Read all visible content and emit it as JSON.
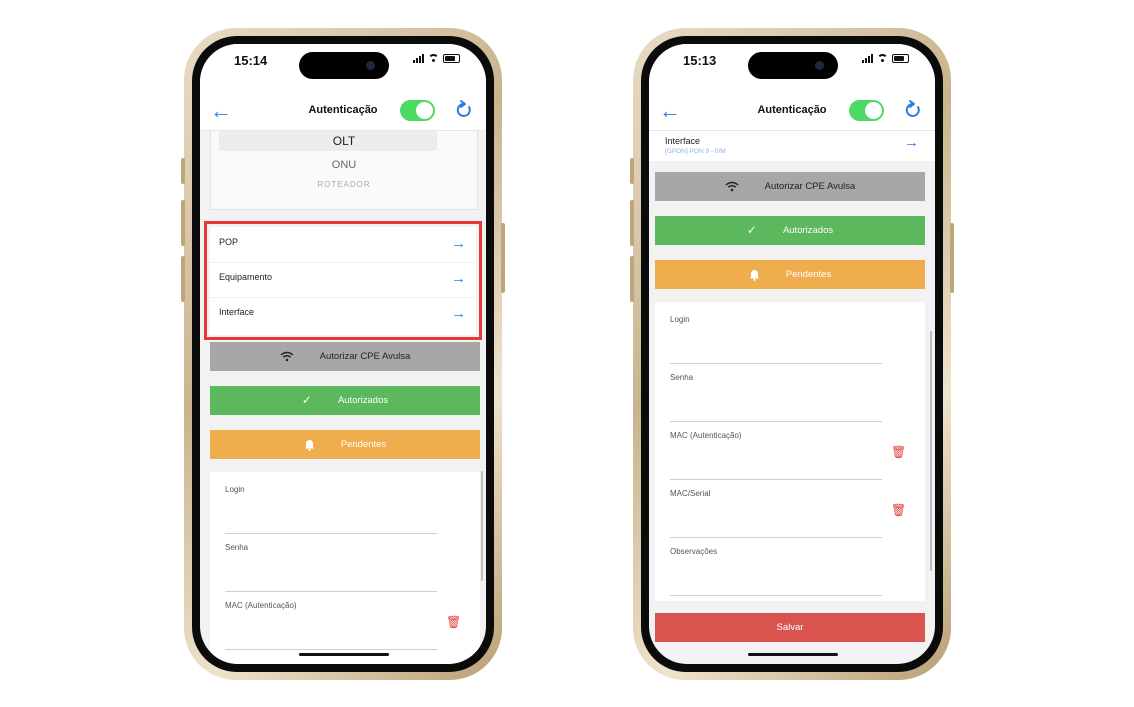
{
  "left_phone": {
    "status": {
      "time": "15:14"
    },
    "navbar": {
      "title": "Autenticação",
      "toggle_on": true
    },
    "picker": {
      "options": [
        "OLT",
        "ONU",
        "ROTEADOR"
      ],
      "selected": "OLT"
    },
    "nav_rows": [
      {
        "label": "POP"
      },
      {
        "label": "Equipamento"
      },
      {
        "label": "Interface"
      }
    ],
    "buttons": {
      "authorize_cpe": "Autorizar CPE Avulsa",
      "authorized": "Autorizados",
      "pending": "Pendentes"
    },
    "form_fields": [
      "Login",
      "Senha",
      "MAC (Autenticação)"
    ]
  },
  "right_phone": {
    "status": {
      "time": "15:13"
    },
    "navbar": {
      "title": "Autenticação",
      "toggle_on": true
    },
    "interface_row": {
      "label": "Interface",
      "value": "[GPON] PON 9 - 0/M"
    },
    "buttons": {
      "authorize_cpe": "Autorizar CPE Avulsa",
      "authorized": "Autorizados",
      "pending": "Pendentes",
      "save": "Salvar"
    },
    "form_fields": [
      "Login",
      "Senha",
      "MAC (Autenticação)",
      "MAC/Serial",
      "Observações"
    ]
  },
  "colors": {
    "accent": "#2a7de1",
    "toggle": "#4cd964",
    "success": "#5cb85c",
    "warning": "#f0ad4e",
    "danger": "#d9534f",
    "highlight": "#e53935",
    "neutral_button": "#a7a7a7"
  },
  "icons": [
    "back-arrow-icon",
    "refresh-icon",
    "wifi-icon",
    "check-icon",
    "bell-icon",
    "arrow-right-icon",
    "trash-icon"
  ]
}
